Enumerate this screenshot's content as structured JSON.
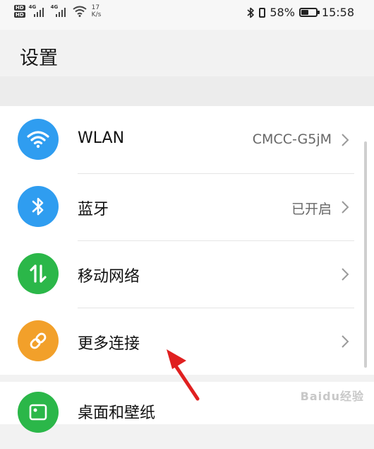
{
  "status_bar": {
    "hd": "HD",
    "signal_tag": "4G",
    "speed_value": "17",
    "speed_unit": "K/s",
    "battery": "58%",
    "battery_level": 0.58,
    "time": "15:58"
  },
  "page": {
    "title": "设置"
  },
  "items": [
    {
      "label": "WLAN",
      "value": "CMCC-G5jM",
      "icon": "wifi-icon",
      "color": "#2f9df0"
    },
    {
      "label": "蓝牙",
      "value": "已开启",
      "icon": "bluetooth-icon",
      "color": "#2f9df0"
    },
    {
      "label": "移动网络",
      "value": "",
      "icon": "mobile-data-icon",
      "color": "#2bb749"
    },
    {
      "label": "更多连接",
      "value": "",
      "icon": "link-icon",
      "color": "#f2a02a"
    },
    {
      "label": "桌面和壁纸",
      "value": "",
      "icon": "wallpaper-icon",
      "color": "#2bb749"
    }
  ],
  "watermark": "Baidu经验"
}
